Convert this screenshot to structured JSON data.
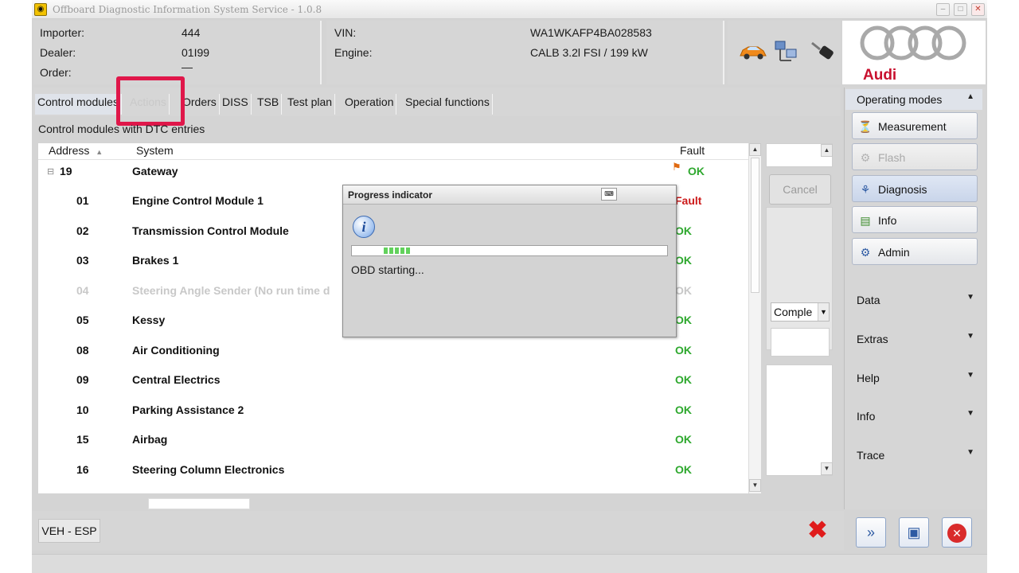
{
  "window": {
    "title": "Offboard Diagnostic Information System Service - 1.0.8",
    "controls": {
      "minimize": "–",
      "maximize": "□",
      "close": "✕"
    }
  },
  "header": {
    "importer_label": "Importer:",
    "importer_value": "444",
    "dealer_label": "Dealer:",
    "dealer_value": "01I99",
    "order_label": "Order:",
    "order_value": "—",
    "vin_label": "VIN:",
    "vin_value": "WA1WKAFP4BA028583",
    "engine_label": "Engine:",
    "engine_value": "CALB 3.2l FSI / 199 kW",
    "brand": "Audi"
  },
  "tabs": [
    {
      "label": "Control modules"
    },
    {
      "label": "Actions"
    },
    {
      "label": "Orders"
    },
    {
      "label": "DISS"
    },
    {
      "label": "TSB"
    },
    {
      "label": "Test plan"
    },
    {
      "label": "Operation"
    },
    {
      "label": "Special functions"
    }
  ],
  "table": {
    "subtitle": "Control modules with DTC entries",
    "col_address": "Address",
    "col_system": "System",
    "col_fault": "Fault",
    "rows": [
      {
        "address": "19",
        "system": "Gateway",
        "status": "OK"
      },
      {
        "address": "01",
        "system": "Engine Control Module 1",
        "status": "Fault"
      },
      {
        "address": "02",
        "system": "Transmission Control Module",
        "status": "OK"
      },
      {
        "address": "03",
        "system": "Brakes 1",
        "status": "OK"
      },
      {
        "address": "04",
        "system": "Steering Angle Sender  (No run time d",
        "status": "OK"
      },
      {
        "address": "05",
        "system": "Kessy",
        "status": "OK"
      },
      {
        "address": "08",
        "system": "Air Conditioning",
        "status": "OK"
      },
      {
        "address": "09",
        "system": "Central Electrics",
        "status": "OK"
      },
      {
        "address": "10",
        "system": "Parking Assistance 2",
        "status": "OK"
      },
      {
        "address": "15",
        "system": "Airbag",
        "status": "OK"
      },
      {
        "address": "16",
        "system": "Steering Column Electronics",
        "status": "OK"
      }
    ]
  },
  "side_controls": {
    "cancel": "Cancel",
    "combo_value": "Comple"
  },
  "modal": {
    "title": "Progress indicator",
    "message": "OBD starting...",
    "progress_start": 0.1,
    "progress_end": 0.19
  },
  "bottom": {
    "veh_button": "VEH - ESP"
  },
  "right_panel": {
    "operating_modes": "Operating modes",
    "buttons": [
      {
        "label": "Measurement",
        "icon": "gauge-icon"
      },
      {
        "label": "Flash",
        "icon": "flash-icon"
      },
      {
        "label": "Diagnosis",
        "icon": "stethoscope-icon"
      },
      {
        "label": "Info",
        "icon": "books-icon"
      },
      {
        "label": "Admin",
        "icon": "gear-icon"
      }
    ],
    "sections": [
      "Data",
      "Extras",
      "Help",
      "Info",
      "Trace"
    ]
  },
  "colors": {
    "ok_green": "#2ea82e",
    "fault_red": "#cc1a1a",
    "highlight": "#e0174a",
    "audi_red": "#c8102e"
  }
}
